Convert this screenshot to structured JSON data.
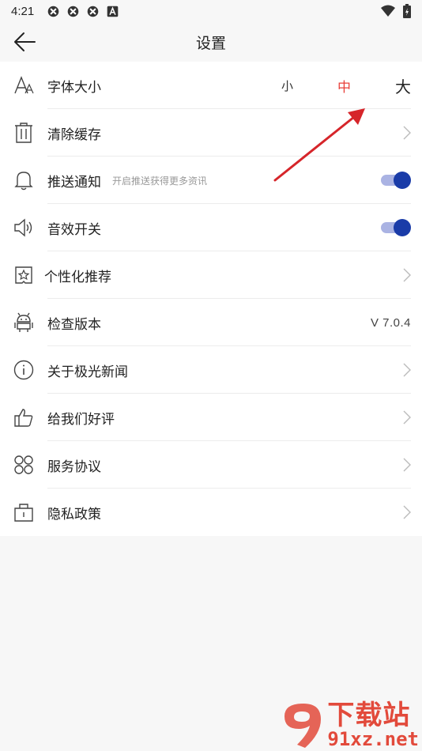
{
  "status_bar": {
    "time": "4:21"
  },
  "header": {
    "title": "设置"
  },
  "font_size": {
    "label": "字体大小",
    "small": "小",
    "medium": "中",
    "large": "大",
    "selected": "中"
  },
  "rows": {
    "clear_cache": {
      "label": "清除缓存"
    },
    "push": {
      "label": "推送通知",
      "hint": "开启推送获得更多资讯",
      "enabled": true
    },
    "sound": {
      "label": "音效开关",
      "enabled": true
    },
    "personalized": {
      "label": "个性化推荐"
    },
    "version": {
      "label": "检查版本",
      "value": "V 7.0.4"
    },
    "about": {
      "label": "关于极光新闻"
    },
    "rate": {
      "label": "给我们好评"
    },
    "service": {
      "label": "服务协议"
    },
    "privacy": {
      "label": "隐私政策"
    }
  },
  "watermark": {
    "line1": "下载站",
    "line2": "91xz.net"
  },
  "colors": {
    "accent_red": "#e8403a",
    "toggle_knob": "#1a3ca8",
    "toggle_track": "#aab3e3"
  }
}
